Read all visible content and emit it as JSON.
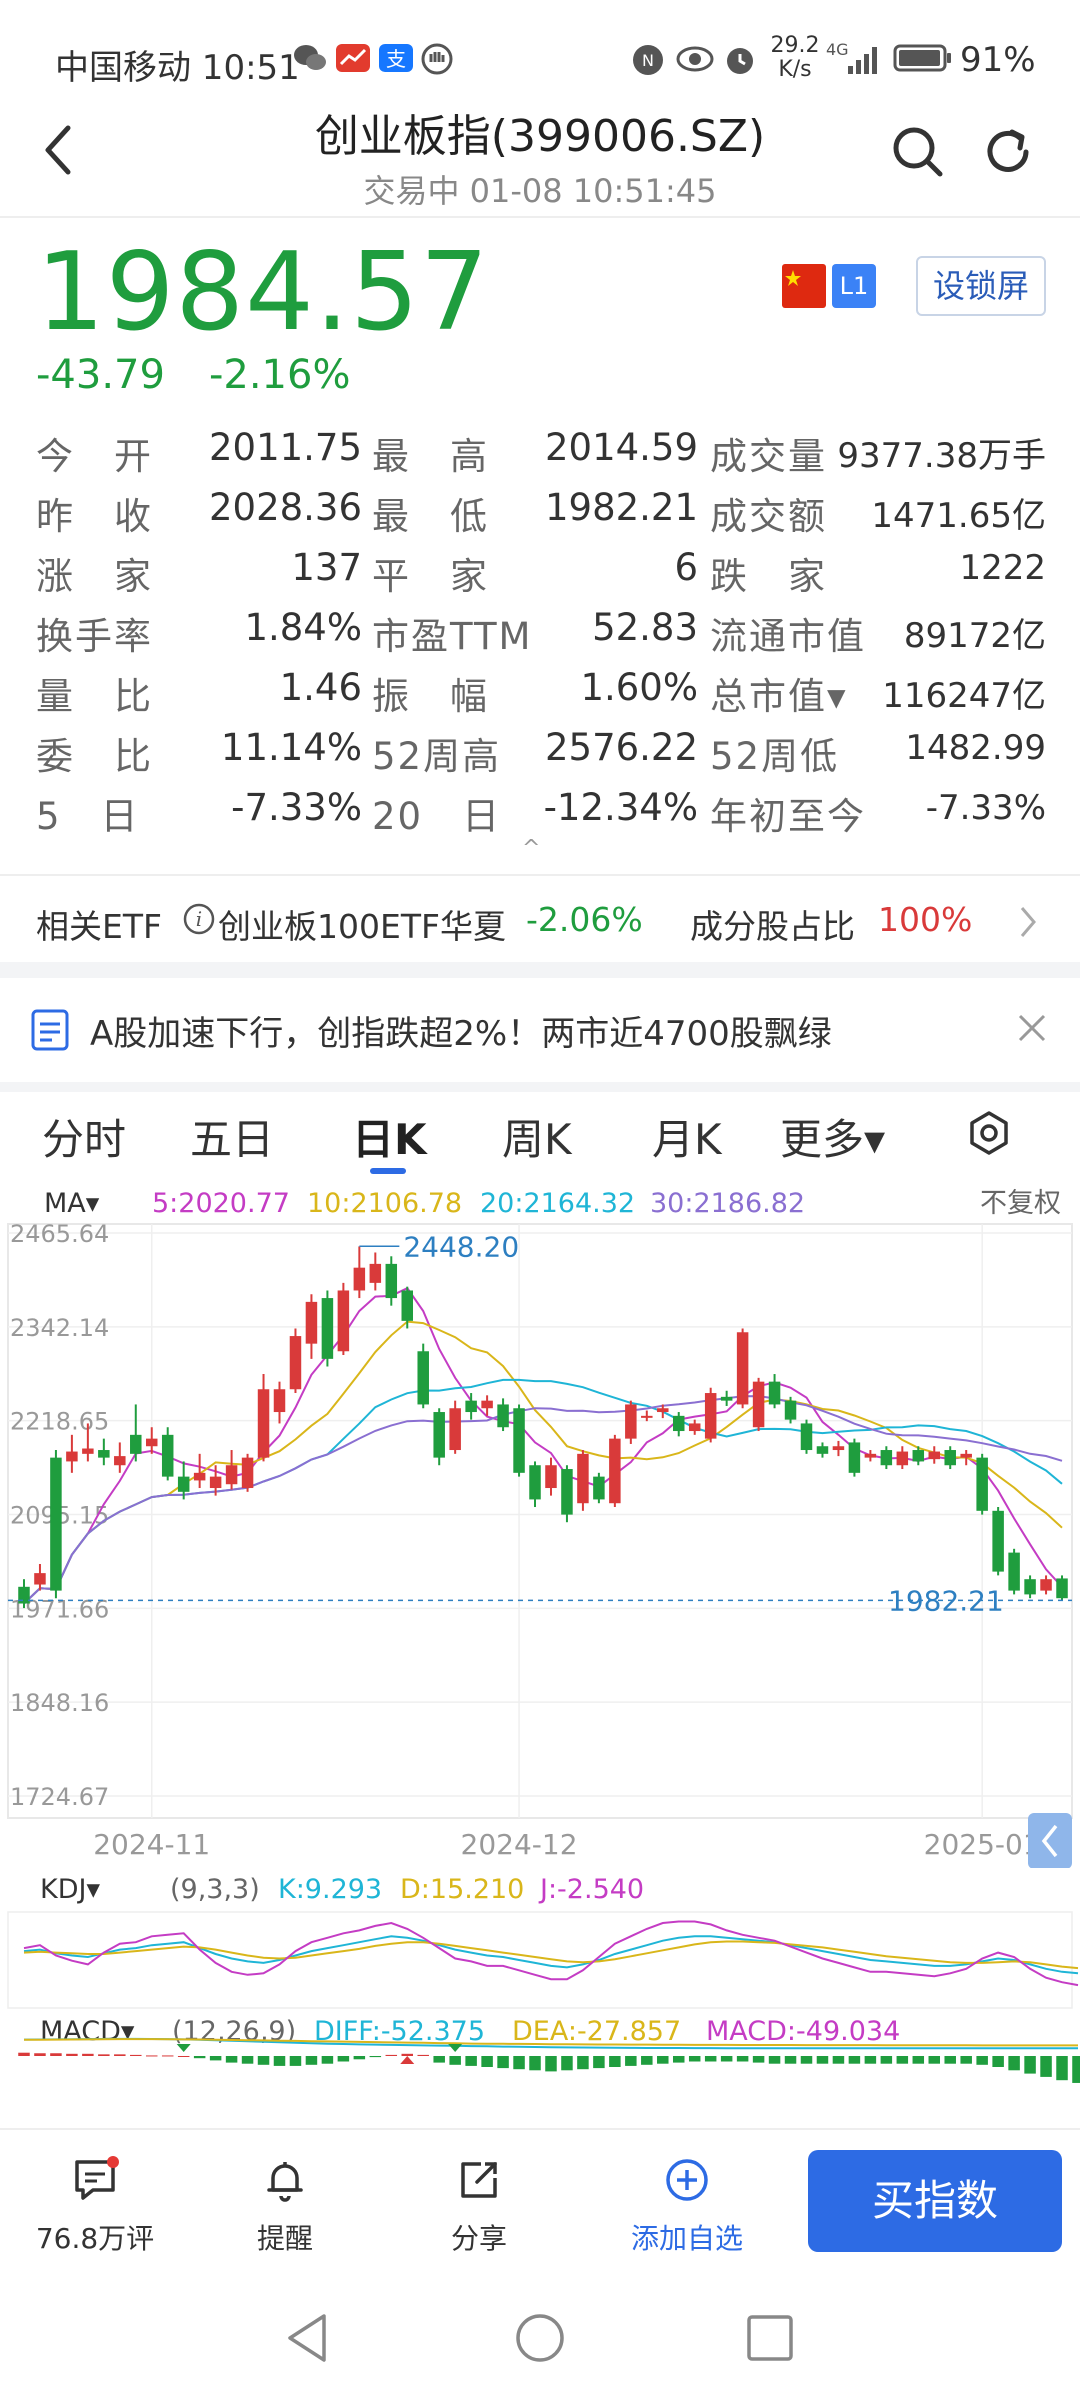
{
  "status_bar": {
    "carrier_time": "中国移动 10:51",
    "net_speed_value": "29.2",
    "net_speed_unit": "K/s",
    "signal": "4G",
    "battery": "91%"
  },
  "header": {
    "title": "创业板指(399006.SZ)",
    "subtitle": "交易中 01-08 10:51:45"
  },
  "quote": {
    "price": "1984.57",
    "change": "-43.79",
    "change_pct": "-2.16%",
    "level_badge": "L1",
    "lock_label": "设锁屏",
    "colors": {
      "down": "#1f9d3e",
      "up": "#d93a3a"
    }
  },
  "stats": [
    [
      {
        "label": "今　开",
        "value": "2011.75",
        "tone": "down"
      },
      {
        "label": "最　高",
        "value": "2014.59",
        "tone": "down"
      },
      {
        "label": "成交量",
        "value": "9377.38万手",
        "tone": ""
      }
    ],
    [
      {
        "label": "昨　收",
        "value": "2028.36",
        "tone": ""
      },
      {
        "label": "最　低",
        "value": "1982.21",
        "tone": "down"
      },
      {
        "label": "成交额",
        "value": "1471.65亿",
        "tone": ""
      }
    ],
    [
      {
        "label": "涨　家",
        "value": "137",
        "tone": ""
      },
      {
        "label": "平　家",
        "value": "6",
        "tone": ""
      },
      {
        "label": "跌　家",
        "value": "1222",
        "tone": ""
      }
    ],
    [
      {
        "label": "换手率",
        "value": "1.84%",
        "tone": ""
      },
      {
        "label": "市盈TTM",
        "value": "52.83",
        "tone": ""
      },
      {
        "label": "流通市值",
        "value": "89172亿",
        "tone": ""
      }
    ],
    [
      {
        "label": "量　比",
        "value": "1.46",
        "tone": "up"
      },
      {
        "label": "振　幅",
        "value": "1.60%",
        "tone": ""
      },
      {
        "label": "总市值▾",
        "value": "116247亿",
        "tone": ""
      }
    ],
    [
      {
        "label": "委　比",
        "value": "11.14%",
        "tone": "up"
      },
      {
        "label": "52周高",
        "value": "2576.22",
        "tone": ""
      },
      {
        "label": "52周低",
        "value": "1482.99",
        "tone": ""
      }
    ],
    [
      {
        "label": "5　日",
        "value": "-7.33%",
        "tone": ""
      },
      {
        "label": "20　日",
        "value": "-12.34%",
        "tone": ""
      },
      {
        "label": "年初至今",
        "value": "-7.33%",
        "tone": ""
      }
    ]
  ],
  "etf": {
    "label": "相关ETF",
    "name": "创业板100ETF华夏",
    "change": "-2.06%",
    "component_label": "成分股占比",
    "component_value": "100%"
  },
  "news": {
    "text": "A股加速下行，创指跌超2%！两市近4700股飘绿"
  },
  "tabs": [
    {
      "label": "分时",
      "active": false
    },
    {
      "label": "五日",
      "active": false
    },
    {
      "label": "日K",
      "active": true
    },
    {
      "label": "周K",
      "active": false
    },
    {
      "label": "月K",
      "active": false
    },
    {
      "label": "更多▾",
      "active": false
    }
  ],
  "ma_legend": {
    "label": "MA▾",
    "items": [
      {
        "text": "5:2020.77",
        "color": "#c43cc4"
      },
      {
        "text": "10:2106.78",
        "color": "#d9b61a"
      },
      {
        "text": "20:2164.32",
        "color": "#1fb5d6"
      },
      {
        "text": "30:2186.82",
        "color": "#8a6fd1"
      }
    ],
    "adjust_label": "不复权"
  },
  "chart_data": [
    {
      "type": "candlestick",
      "title": "",
      "y_ticks": [
        "2465.64",
        "2342.14",
        "2218.65",
        "2095.15",
        "1971.66",
        "1848.16",
        "1724.67"
      ],
      "ylim": [
        1724.67,
        2465.64
      ],
      "x_ticks": [
        "2024-11",
        "2024-12",
        "2025-01"
      ],
      "annotations": {
        "high": "2448.20",
        "low": "1982.21"
      },
      "candles": [
        {
          "o": 2000,
          "c": 1978,
          "h": 2010,
          "l": 1972
        },
        {
          "o": 2003,
          "c": 2018,
          "h": 2030,
          "l": 1995
        },
        {
          "o": 2170,
          "c": 1995,
          "h": 2180,
          "l": 1985
        },
        {
          "o": 2165,
          "c": 2178,
          "h": 2200,
          "l": 2150
        },
        {
          "o": 2175,
          "c": 2182,
          "h": 2215,
          "l": 2165
        },
        {
          "o": 2180,
          "c": 2170,
          "h": 2195,
          "l": 2160
        },
        {
          "o": 2160,
          "c": 2172,
          "h": 2190,
          "l": 2150
        },
        {
          "o": 2200,
          "c": 2175,
          "h": 2240,
          "l": 2165
        },
        {
          "o": 2185,
          "c": 2195,
          "h": 2210,
          "l": 2175
        },
        {
          "o": 2200,
          "c": 2145,
          "h": 2210,
          "l": 2140
        },
        {
          "o": 2145,
          "c": 2125,
          "h": 2165,
          "l": 2115
        },
        {
          "o": 2140,
          "c": 2150,
          "h": 2175,
          "l": 2130
        },
        {
          "o": 2130,
          "c": 2145,
          "h": 2160,
          "l": 2120
        },
        {
          "o": 2135,
          "c": 2160,
          "h": 2180,
          "l": 2128
        },
        {
          "o": 2130,
          "c": 2170,
          "h": 2175,
          "l": 2125
        },
        {
          "o": 2170,
          "c": 2260,
          "h": 2280,
          "l": 2165
        },
        {
          "o": 2230,
          "c": 2260,
          "h": 2270,
          "l": 2215
        },
        {
          "o": 2260,
          "c": 2330,
          "h": 2340,
          "l": 2255
        },
        {
          "o": 2320,
          "c": 2375,
          "h": 2385,
          "l": 2300
        },
        {
          "o": 2380,
          "c": 2300,
          "h": 2390,
          "l": 2290
        },
        {
          "o": 2310,
          "c": 2390,
          "h": 2400,
          "l": 2305
        },
        {
          "o": 2390,
          "c": 2420,
          "h": 2448,
          "l": 2380
        },
        {
          "o": 2400,
          "c": 2425,
          "h": 2440,
          "l": 2390
        },
        {
          "o": 2425,
          "c": 2380,
          "h": 2435,
          "l": 2370
        },
        {
          "o": 2390,
          "c": 2350,
          "h": 2395,
          "l": 2340
        },
        {
          "o": 2310,
          "c": 2240,
          "h": 2320,
          "l": 2235
        },
        {
          "o": 2230,
          "c": 2170,
          "h": 2235,
          "l": 2160
        },
        {
          "o": 2180,
          "c": 2235,
          "h": 2245,
          "l": 2175
        },
        {
          "o": 2245,
          "c": 2230,
          "h": 2255,
          "l": 2220
        },
        {
          "o": 2235,
          "c": 2245,
          "h": 2252,
          "l": 2225
        },
        {
          "o": 2240,
          "c": 2210,
          "h": 2248,
          "l": 2205
        },
        {
          "o": 2235,
          "c": 2150,
          "h": 2240,
          "l": 2145
        },
        {
          "o": 2160,
          "c": 2115,
          "h": 2165,
          "l": 2105
        },
        {
          "o": 2130,
          "c": 2160,
          "h": 2170,
          "l": 2120
        },
        {
          "o": 2155,
          "c": 2095,
          "h": 2160,
          "l": 2085
        },
        {
          "o": 2110,
          "c": 2175,
          "h": 2180,
          "l": 2100
        },
        {
          "o": 2145,
          "c": 2115,
          "h": 2150,
          "l": 2110
        },
        {
          "o": 2110,
          "c": 2195,
          "h": 2200,
          "l": 2105
        },
        {
          "o": 2195,
          "c": 2240,
          "h": 2245,
          "l": 2188
        },
        {
          "o": 2225,
          "c": 2225,
          "h": 2232,
          "l": 2218
        },
        {
          "o": 2230,
          "c": 2235,
          "h": 2240,
          "l": 2222
        },
        {
          "o": 2225,
          "c": 2205,
          "h": 2230,
          "l": 2198
        },
        {
          "o": 2205,
          "c": 2215,
          "h": 2220,
          "l": 2200
        },
        {
          "o": 2195,
          "c": 2255,
          "h": 2262,
          "l": 2190
        },
        {
          "o": 2250,
          "c": 2245,
          "h": 2258,
          "l": 2238
        },
        {
          "o": 2240,
          "c": 2335,
          "h": 2340,
          "l": 2235
        },
        {
          "o": 2210,
          "c": 2270,
          "h": 2275,
          "l": 2205
        },
        {
          "o": 2270,
          "c": 2240,
          "h": 2280,
          "l": 2235
        },
        {
          "o": 2245,
          "c": 2220,
          "h": 2250,
          "l": 2215
        },
        {
          "o": 2215,
          "c": 2180,
          "h": 2220,
          "l": 2175
        },
        {
          "o": 2185,
          "c": 2175,
          "h": 2190,
          "l": 2170
        },
        {
          "o": 2180,
          "c": 2185,
          "h": 2192,
          "l": 2172
        },
        {
          "o": 2190,
          "c": 2150,
          "h": 2195,
          "l": 2145
        },
        {
          "o": 2170,
          "c": 2175,
          "h": 2180,
          "l": 2165
        },
        {
          "o": 2180,
          "c": 2160,
          "h": 2185,
          "l": 2155
        },
        {
          "o": 2160,
          "c": 2178,
          "h": 2185,
          "l": 2155
        },
        {
          "o": 2180,
          "c": 2165,
          "h": 2185,
          "l": 2160
        },
        {
          "o": 2168,
          "c": 2178,
          "h": 2185,
          "l": 2162
        },
        {
          "o": 2180,
          "c": 2160,
          "h": 2185,
          "l": 2155
        },
        {
          "o": 2170,
          "c": 2175,
          "h": 2180,
          "l": 2160
        },
        {
          "o": 2170,
          "c": 2100,
          "h": 2175,
          "l": 2095
        },
        {
          "o": 2100,
          "c": 2020,
          "h": 2105,
          "l": 2015
        },
        {
          "o": 2045,
          "c": 1995,
          "h": 2050,
          "l": 1990
        },
        {
          "o": 2010,
          "c": 1990,
          "h": 2015,
          "l": 1985
        },
        {
          "o": 1995,
          "c": 2010,
          "h": 2015,
          "l": 1990
        },
        {
          "o": 2011,
          "c": 1985,
          "h": 2015,
          "l": 1982
        }
      ]
    },
    {
      "type": "line",
      "title": "",
      "legend_label": "KDJ▾",
      "params": "(9,3,3)",
      "series": [
        {
          "name": "K:9.293",
          "color": "#1fb5d6",
          "values": [
            58,
            60,
            55,
            52,
            50,
            55,
            60,
            62,
            66,
            68,
            70,
            62,
            54,
            48,
            44,
            42,
            46,
            52,
            58,
            62,
            66,
            70,
            74,
            78,
            76,
            72,
            66,
            60,
            56,
            52,
            50,
            46,
            42,
            38,
            36,
            40,
            46,
            54,
            60,
            66,
            72,
            76,
            78,
            78,
            76,
            74,
            72,
            70,
            66,
            62,
            58,
            54,
            50,
            46,
            44,
            42,
            40,
            38,
            38,
            40,
            44,
            48,
            46,
            40,
            34,
            30,
            28
          ]
        },
        {
          "name": "D:15.210",
          "color": "#d9b61a",
          "values": [
            56,
            57,
            56,
            55,
            54,
            54,
            56,
            58,
            60,
            62,
            64,
            63,
            60,
            56,
            52,
            49,
            48,
            49,
            52,
            55,
            58,
            61,
            65,
            68,
            70,
            70,
            68,
            65,
            62,
            59,
            56,
            53,
            50,
            47,
            44,
            43,
            44,
            47,
            51,
            55,
            59,
            63,
            67,
            70,
            71,
            71,
            70,
            69,
            67,
            65,
            63,
            60,
            57,
            54,
            51,
            49,
            47,
            45,
            43,
            42,
            42,
            43,
            44,
            43,
            40,
            37,
            35
          ]
        },
        {
          "name": "J:-2.540",
          "color": "#c43cc4",
          "values": [
            62,
            66,
            52,
            45,
            40,
            56,
            68,
            70,
            78,
            80,
            82,
            60,
            42,
            30,
            26,
            28,
            40,
            58,
            70,
            76,
            82,
            86,
            92,
            96,
            88,
            76,
            62,
            48,
            44,
            38,
            38,
            32,
            26,
            20,
            20,
            32,
            50,
            68,
            78,
            88,
            96,
            98,
            98,
            94,
            86,
            80,
            76,
            72,
            64,
            56,
            48,
            42,
            36,
            30,
            30,
            28,
            26,
            24,
            28,
            34,
            48,
            56,
            50,
            34,
            22,
            16,
            12
          ]
        }
      ],
      "ylim": [
        0,
        100
      ]
    },
    {
      "type": "bar",
      "title": "",
      "legend_label": "MACD▾",
      "params": "(12,26,9)",
      "series": [
        {
          "name": "DIFF:-52.375",
          "color": "#1fb5d6",
          "values": [
            20,
            21,
            22,
            23,
            24,
            25,
            26,
            26,
            25,
            24,
            22,
            18,
            14,
            10,
            6,
            2,
            -2,
            -6,
            -10,
            -14,
            -17,
            -20,
            -22,
            -24,
            -26,
            -28,
            -30,
            -32,
            -34,
            -36,
            -38,
            -40,
            -42,
            -44,
            -45,
            -46,
            -47,
            -48,
            -49,
            -50,
            -50,
            -50,
            -51,
            -51,
            -52,
            -52,
            -52,
            -52,
            -52,
            -52,
            -52,
            -52,
            -52,
            -52,
            -52,
            -52,
            -52,
            -52,
            -52,
            -52,
            -52,
            -52,
            -52,
            -52,
            -52,
            -52,
            -52
          ]
        },
        {
          "name": "DEA:-27.857",
          "color": "#d9b61a",
          "values": [
            18,
            19,
            20,
            21,
            22,
            23,
            24,
            24,
            24,
            23,
            22,
            21,
            19,
            17,
            15,
            13,
            11,
            9,
            7,
            5,
            3,
            1,
            -1,
            -3,
            -5,
            -7,
            -9,
            -11,
            -13,
            -14,
            -15,
            -16,
            -17,
            -18,
            -19,
            -20,
            -21,
            -21,
            -22,
            -22,
            -23,
            -23,
            -24,
            -24,
            -24,
            -25,
            -25,
            -25,
            -25,
            -26,
            -26,
            -26,
            -26,
            -26,
            -27,
            -27,
            -27,
            -27,
            -27,
            -27,
            -28,
            -28,
            -28,
            -28,
            -28,
            -28,
            -28
          ]
        },
        {
          "name": "MACD:-49.034",
          "color": "#c43cc4",
          "values": [
            6,
            5,
            5,
            4,
            4,
            3,
            3,
            2,
            1,
            1,
            0,
            -4,
            -8,
            -12,
            -14,
            -16,
            -18,
            -18,
            -16,
            -14,
            -10,
            -6,
            -2,
            2,
            4,
            2,
            -12,
            -16,
            -18,
            -20,
            -22,
            -24,
            -26,
            -28,
            -26,
            -24,
            -22,
            -20,
            -18,
            -16,
            -14,
            -12,
            -10,
            -10,
            -10,
            -10,
            -12,
            -14,
            -14,
            -14,
            -14,
            -14,
            -14,
            -14,
            -14,
            -14,
            -14,
            -14,
            -14,
            -14,
            -16,
            -20,
            -26,
            -32,
            -38,
            -44,
            -49
          ]
        }
      ]
    }
  ],
  "bottom_bar": {
    "comments": "76.8万评",
    "remind": "提醒",
    "share": "分享",
    "watch": "添加自选",
    "buy": "买指数"
  }
}
